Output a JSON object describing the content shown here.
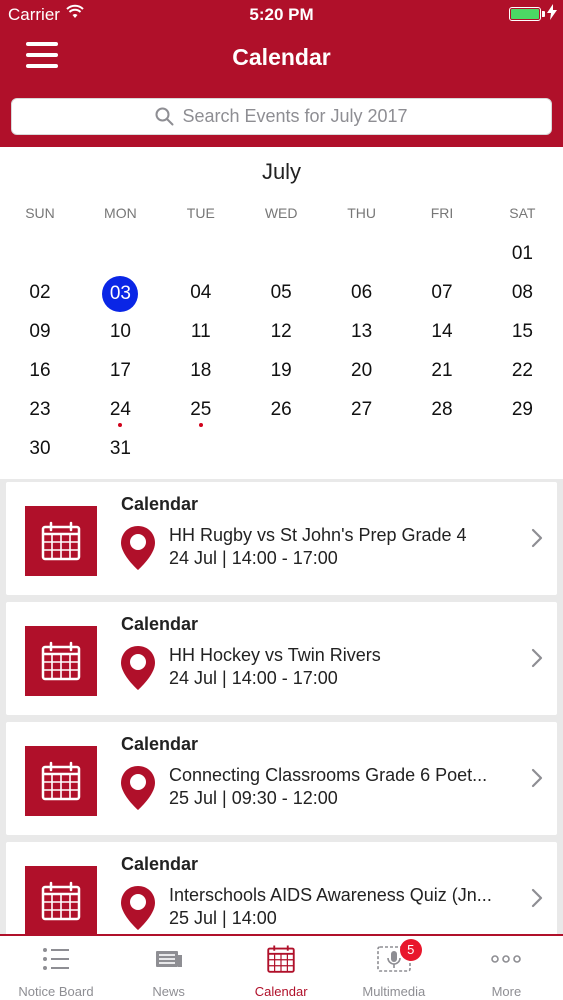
{
  "status_bar": {
    "carrier": "Carrier",
    "time": "5:20 PM"
  },
  "header": {
    "title": "Calendar"
  },
  "search": {
    "placeholder": "Search Events for July 2017"
  },
  "calendar": {
    "month": "July",
    "weekdays": [
      "SUN",
      "MON",
      "TUE",
      "WED",
      "THU",
      "FRI",
      "SAT"
    ],
    "weeks": [
      [
        "",
        "",
        "",
        "",
        "",
        "",
        "01"
      ],
      [
        "02",
        "03",
        "04",
        "05",
        "06",
        "07",
        "08"
      ],
      [
        "09",
        "10",
        "11",
        "12",
        "13",
        "14",
        "15"
      ],
      [
        "16",
        "17",
        "18",
        "19",
        "20",
        "21",
        "22"
      ],
      [
        "23",
        "24",
        "25",
        "26",
        "27",
        "28",
        "29"
      ],
      [
        "30",
        "31",
        "",
        "",
        "",
        "",
        ""
      ]
    ],
    "selected": "03",
    "event_days": [
      "24",
      "25"
    ]
  },
  "events": [
    {
      "heading": "Calendar",
      "title": "HH Rugby vs St John's Prep Grade 4",
      "when": "24 Jul | 14:00 - 17:00"
    },
    {
      "heading": "Calendar",
      "title": "HH Hockey vs Twin Rivers",
      "when": "24 Jul | 14:00 - 17:00"
    },
    {
      "heading": "Calendar",
      "title": "Connecting Classrooms Grade 6 Poet...",
      "when": "25 Jul | 09:30 - 12:00"
    },
    {
      "heading": "Calendar",
      "title": "Interschools AIDS Awareness Quiz (Jn...",
      "when": "25 Jul | 14:00"
    }
  ],
  "tabs": [
    {
      "label": "Notice Board",
      "icon": "list-icon"
    },
    {
      "label": "News",
      "icon": "news-icon"
    },
    {
      "label": "Calendar",
      "icon": "calendar-icon",
      "active": true
    },
    {
      "label": "Multimedia",
      "icon": "microphone-icon",
      "badge": "5"
    },
    {
      "label": "More",
      "icon": "more-icon"
    }
  ],
  "colors": {
    "brand": "#b0102a",
    "selected_day": "#0a26e6",
    "event_dot": "#d0021b",
    "badge": "#e8172c"
  }
}
